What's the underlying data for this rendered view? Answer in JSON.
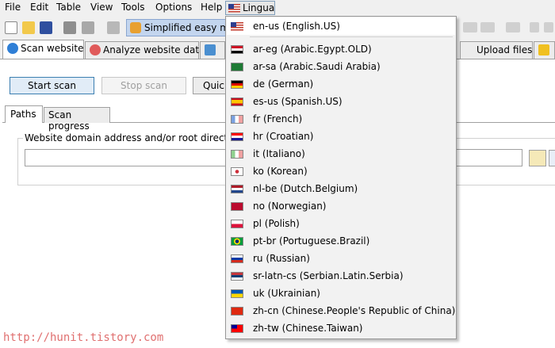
{
  "menubar": {
    "items": [
      "File",
      "Edit",
      "Table",
      "View",
      "Tools",
      "Options",
      "Help"
    ],
    "lingua_label": "Lingua"
  },
  "toolbar": {
    "easy_mode_label": "Simplified easy mo"
  },
  "tabs": {
    "scan": "Scan website",
    "analyze": "Analyze website data",
    "upload": "Upload files"
  },
  "scan_panel": {
    "start_label": "Start scan",
    "stop_label": "Stop scan",
    "quick_label": "Quic",
    "subtab_paths": "Paths",
    "subtab_progress": "Scan progress",
    "group_label": "Website domain address and/or root directory p",
    "address_value": ""
  },
  "language_menu": {
    "current": "en-us (English.US)",
    "items": [
      {
        "label": "ar-eg (Arabic.Egypt.OLD)",
        "flag": "flag-egypt"
      },
      {
        "label": "ar-sa (Arabic.Saudi Arabia)",
        "flag": "flag-saudi-arabia"
      },
      {
        "label": "de (German)",
        "flag": "flag-germany"
      },
      {
        "label": "es-us (Spanish.US)",
        "flag": "flag-spain"
      },
      {
        "label": "fr (French)",
        "flag": "flag-france"
      },
      {
        "label": "hr (Croatian)",
        "flag": "flag-croatia"
      },
      {
        "label": "it (Italiano)",
        "flag": "flag-italy"
      },
      {
        "label": "ko (Korean)",
        "flag": "flag-korea"
      },
      {
        "label": "nl-be (Dutch.Belgium)",
        "flag": "flag-netherlands"
      },
      {
        "label": "no (Norwegian)",
        "flag": "flag-norway"
      },
      {
        "label": "pl (Polish)",
        "flag": "flag-poland"
      },
      {
        "label": "pt-br (Portuguese.Brazil)",
        "flag": "flag-brazil"
      },
      {
        "label": "ru (Russian)",
        "flag": "flag-russia"
      },
      {
        "label": "sr-latn-cs (Serbian.Latin.Serbia)",
        "flag": "flag-serbia"
      },
      {
        "label": "uk (Ukrainian)",
        "flag": "flag-ukraine"
      },
      {
        "label": "zh-cn (Chinese.People's Republic of China)",
        "flag": "flag-china"
      },
      {
        "label": "zh-tw (Chinese.Taiwan)",
        "flag": "flag-taiwan"
      }
    ]
  },
  "watermark": "http://hunit.tistory.com",
  "colors": {
    "menubar_bg": "#f0f0f0",
    "selection": "#c3d5ee",
    "watermark": "#e07070"
  }
}
